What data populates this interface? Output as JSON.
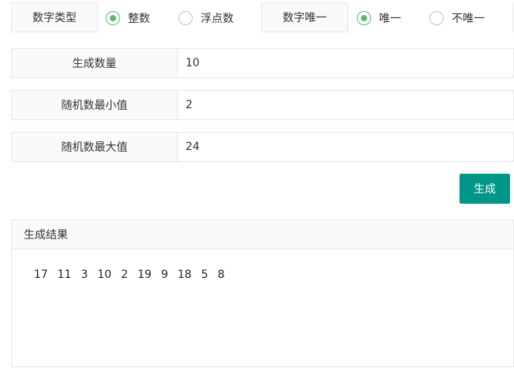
{
  "number_type": {
    "label": "数字类型",
    "options": [
      {
        "label": "整数",
        "checked": true
      },
      {
        "label": "浮点数",
        "checked": false
      }
    ]
  },
  "number_unique": {
    "label": "数字唯一",
    "options": [
      {
        "label": "唯一",
        "checked": true
      },
      {
        "label": "不唯一",
        "checked": false
      }
    ]
  },
  "fields": {
    "count": {
      "label": "生成数量",
      "value": "10"
    },
    "min": {
      "label": "随机数最小值",
      "value": "2"
    },
    "max": {
      "label": "随机数最大值",
      "value": "24"
    }
  },
  "generate_button": "生成",
  "result": {
    "title": "生成结果",
    "numbers": [
      "17",
      "11",
      "3",
      "10",
      "2",
      "19",
      "9",
      "18",
      "5",
      "8"
    ]
  },
  "colors": {
    "accent": "#009688",
    "radio_checked": "#5fb878",
    "border": "#e6e6e6",
    "label_bg": "#fafafa"
  }
}
